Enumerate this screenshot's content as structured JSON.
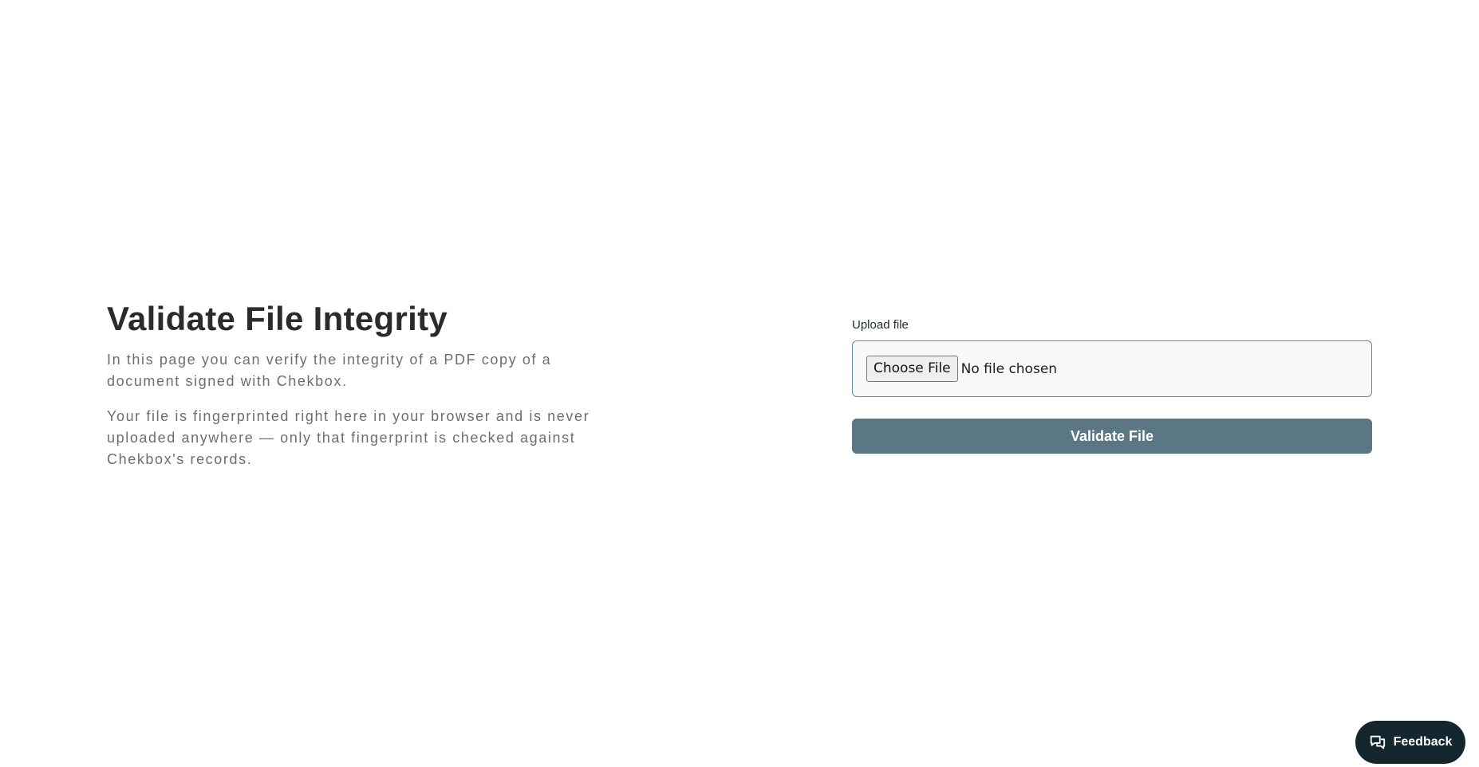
{
  "main": {
    "title": "Validate File Integrity",
    "description_1": "In this page you can verify the integrity of a PDF copy of a document signed with Chekbox.",
    "description_2": "Your file is fingerprinted right here in your browser and is never uploaded anywhere — only that fingerprint is checked against Chekbox's records."
  },
  "upload": {
    "label": "Upload file",
    "choose_button_label": "Choose File",
    "file_status": "No file chosen",
    "validate_button_label": "Validate File"
  },
  "feedback": {
    "label": "Feedback",
    "icon": "chat-bubbles-icon"
  },
  "colors": {
    "validate_button": "#5c7784",
    "feedback_button": "#14262e",
    "file_box_border": "#5e8f9a"
  }
}
